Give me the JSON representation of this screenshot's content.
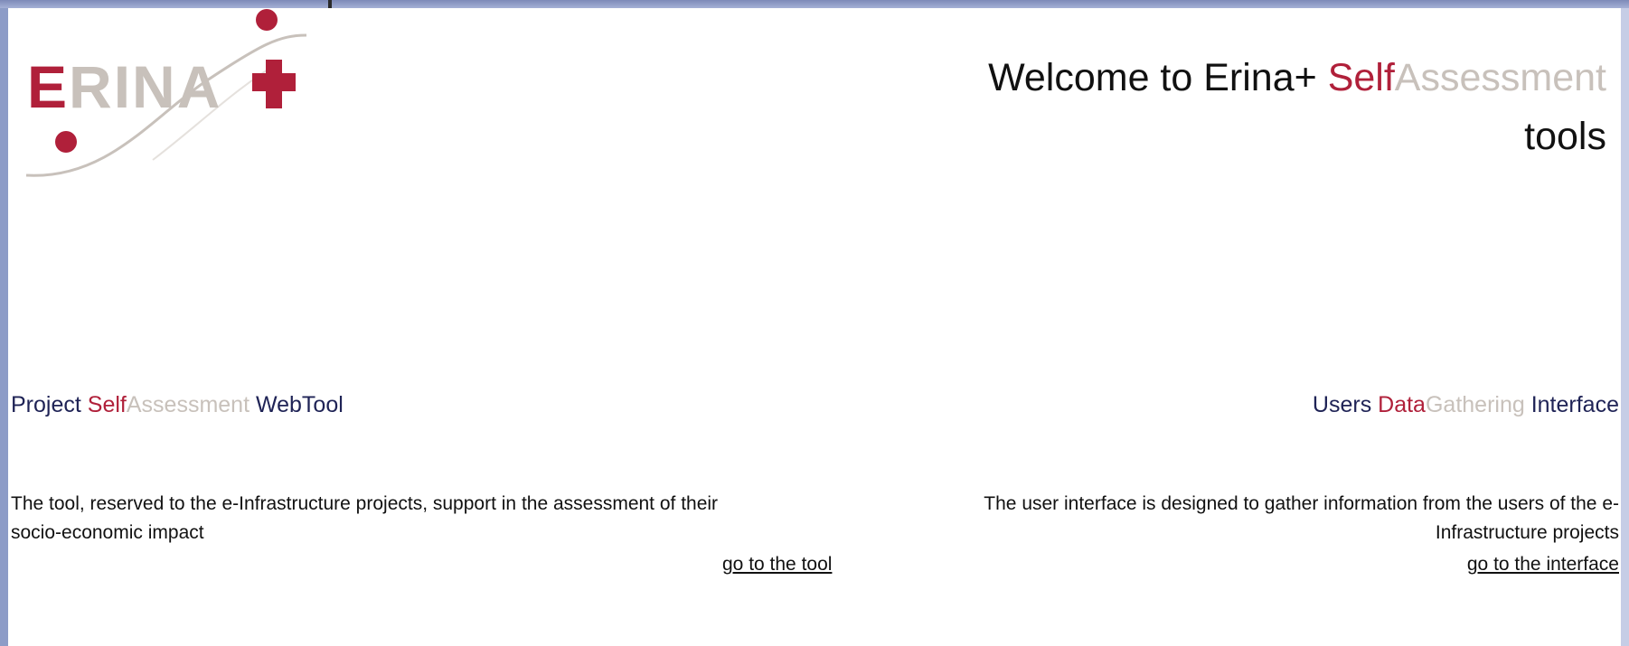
{
  "header": {
    "welcome_prefix": "Welcome to Erina+ ",
    "welcome_self": "Self",
    "welcome_assessment": "Assessment",
    "welcome_tools": "tools"
  },
  "logo": {
    "text": "ERINA",
    "colors": {
      "primary": "#b0203a",
      "secondary": "#c8c1bb"
    }
  },
  "left_section": {
    "title_prefix": "Project ",
    "title_self": "Self",
    "title_assessment": "Assessment",
    "title_suffix": " WebTool",
    "description": "The tool, reserved to the e-Infrastructure projects, support in the assessment of their socio-economic impact",
    "link_label": "go to the tool"
  },
  "right_section": {
    "title_prefix": "Users ",
    "title_data": "Data",
    "title_gathering": "Gathering",
    "title_suffix": " Interface",
    "description_line1": "The user interface is designed to gather information from the users of the e-",
    "description_line2": "Infrastructure projects",
    "link_label": "go to the interface"
  },
  "colors": {
    "accent_red": "#b0203a",
    "light_grey": "#c8c1bb",
    "navy": "#1f2356"
  }
}
